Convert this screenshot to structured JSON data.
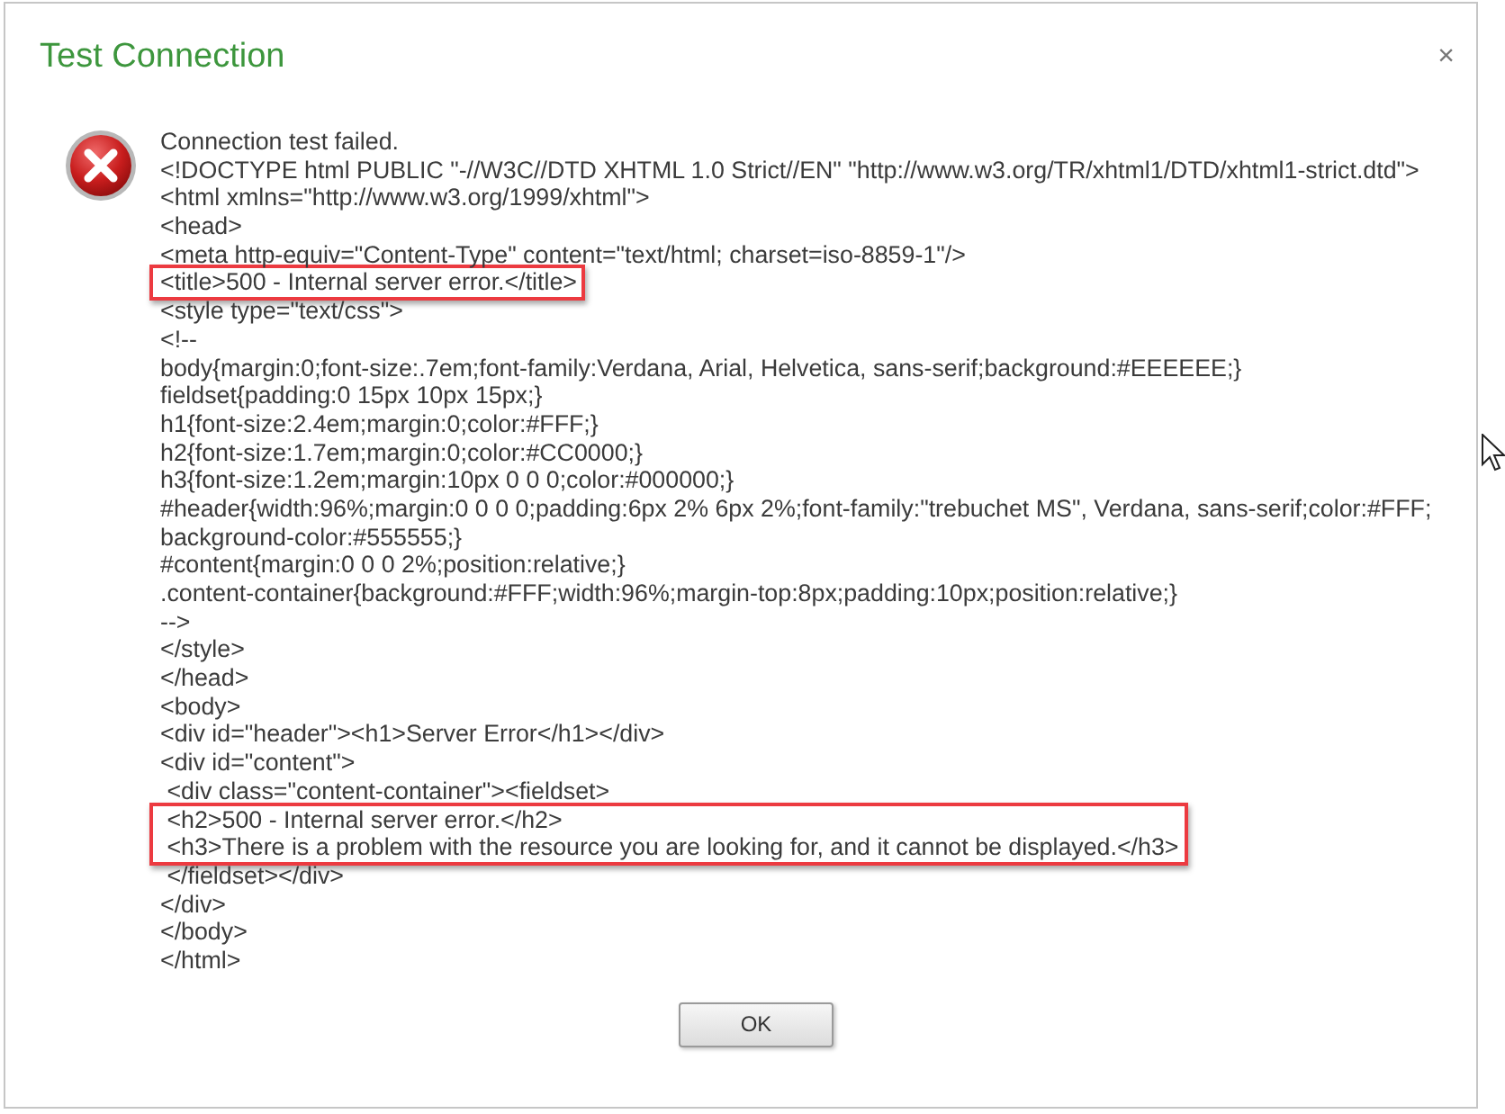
{
  "window": {
    "title": "Test Connection",
    "close": "×"
  },
  "message": {
    "summary": "Connection test failed.",
    "source_lines": [
      {
        "text": "<!DOCTYPE html PUBLIC \"-//W3C//DTD XHTML 1.0 Strict//EN\" \"http://www.w3.org/TR/xhtml1/DTD/xhtml1-strict.dtd\">",
        "highlighted": false
      },
      {
        "text": "<html xmlns=\"http://www.w3.org/1999/xhtml\">",
        "highlighted": false
      },
      {
        "text": "<head>",
        "highlighted": false
      },
      {
        "text": "<meta http-equiv=\"Content-Type\" content=\"text/html; charset=iso-8859-1\"/>",
        "highlighted": false
      },
      {
        "text": "<title>500 - Internal server error.</title>",
        "highlighted": true
      },
      {
        "text": "<style type=\"text/css\">",
        "highlighted": false
      },
      {
        "text": "<!--",
        "highlighted": false
      },
      {
        "text": "body{margin:0;font-size:.7em;font-family:Verdana, Arial, Helvetica, sans-serif;background:#EEEEEE;}",
        "highlighted": false
      },
      {
        "text": "fieldset{padding:0 15px 10px 15px;}",
        "highlighted": false
      },
      {
        "text": "h1{font-size:2.4em;margin:0;color:#FFF;}",
        "highlighted": false
      },
      {
        "text": "h2{font-size:1.7em;margin:0;color:#CC0000;}",
        "highlighted": false
      },
      {
        "text": "h3{font-size:1.2em;margin:10px 0 0 0;color:#000000;}",
        "highlighted": false
      },
      {
        "text": "#header{width:96%;margin:0 0 0 0;padding:6px 2% 6px 2%;font-family:\"trebuchet MS\", Verdana, sans-serif;color:#FFF;",
        "highlighted": false
      },
      {
        "text": "background-color:#555555;}",
        "highlighted": false
      },
      {
        "text": "#content{margin:0 0 0 2%;position:relative;}",
        "highlighted": false
      },
      {
        "text": ".content-container{background:#FFF;width:96%;margin-top:8px;padding:10px;position:relative;}",
        "highlighted": false
      },
      {
        "text": "-->",
        "highlighted": false
      },
      {
        "text": "</style>",
        "highlighted": false
      },
      {
        "text": "</head>",
        "highlighted": false
      },
      {
        "text": "<body>",
        "highlighted": false
      },
      {
        "text": "<div id=\"header\"><h1>Server Error</h1></div>",
        "highlighted": false
      },
      {
        "text": "<div id=\"content\">",
        "highlighted": false
      },
      {
        "text": " <div class=\"content-container\"><fieldset>",
        "highlighted": false
      },
      {
        "text": " <h2>500 - Internal server error.</h2>",
        "highlighted": true
      },
      {
        "text": " <h3>There is a problem with the resource you are looking for, and it cannot be displayed.</h3>",
        "highlighted": true
      },
      {
        "text": " </fieldset></div>",
        "highlighted": false
      },
      {
        "text": "</div>",
        "highlighted": false
      },
      {
        "text": "</body>",
        "highlighted": false
      },
      {
        "text": "</html>",
        "highlighted": false
      }
    ]
  },
  "buttons": [
    {
      "label": "OK"
    }
  ]
}
